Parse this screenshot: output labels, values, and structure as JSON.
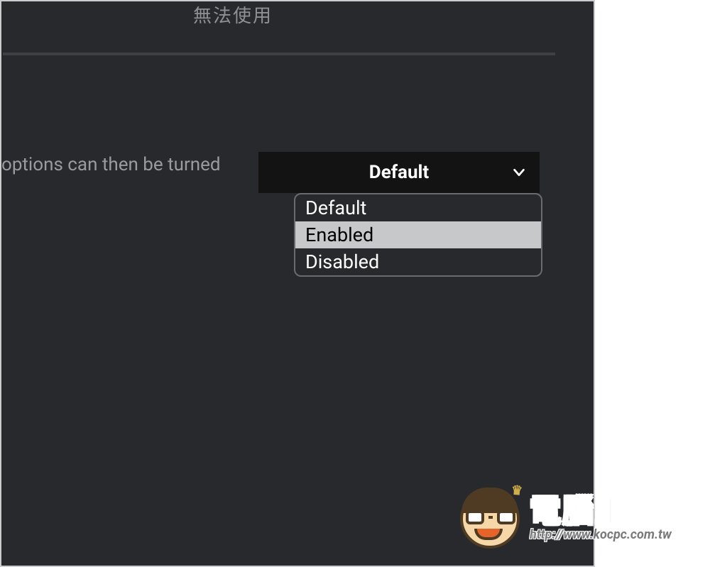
{
  "status_label": "無法使用",
  "description_fragment": "options can then be turned",
  "select": {
    "current": "Default",
    "options": [
      {
        "label": "Default",
        "highlighted": false
      },
      {
        "label": "Enabled",
        "highlighted": true
      },
      {
        "label": "Disabled",
        "highlighted": false
      }
    ]
  },
  "watermark": {
    "title": "電腦王阿達",
    "url": "http://www.kocpc.com.tw"
  }
}
